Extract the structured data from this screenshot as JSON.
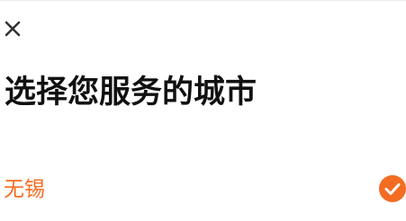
{
  "header": {
    "close_icon": "close-icon"
  },
  "title": "选择您服务的城市",
  "city_list": {
    "items": [
      {
        "name": "无锡",
        "selected": true,
        "icon": "check-circle-icon"
      }
    ]
  },
  "colors": {
    "accent": "#f36c21",
    "title": "#111111",
    "icon": "#333333",
    "divider": "#ececec"
  }
}
